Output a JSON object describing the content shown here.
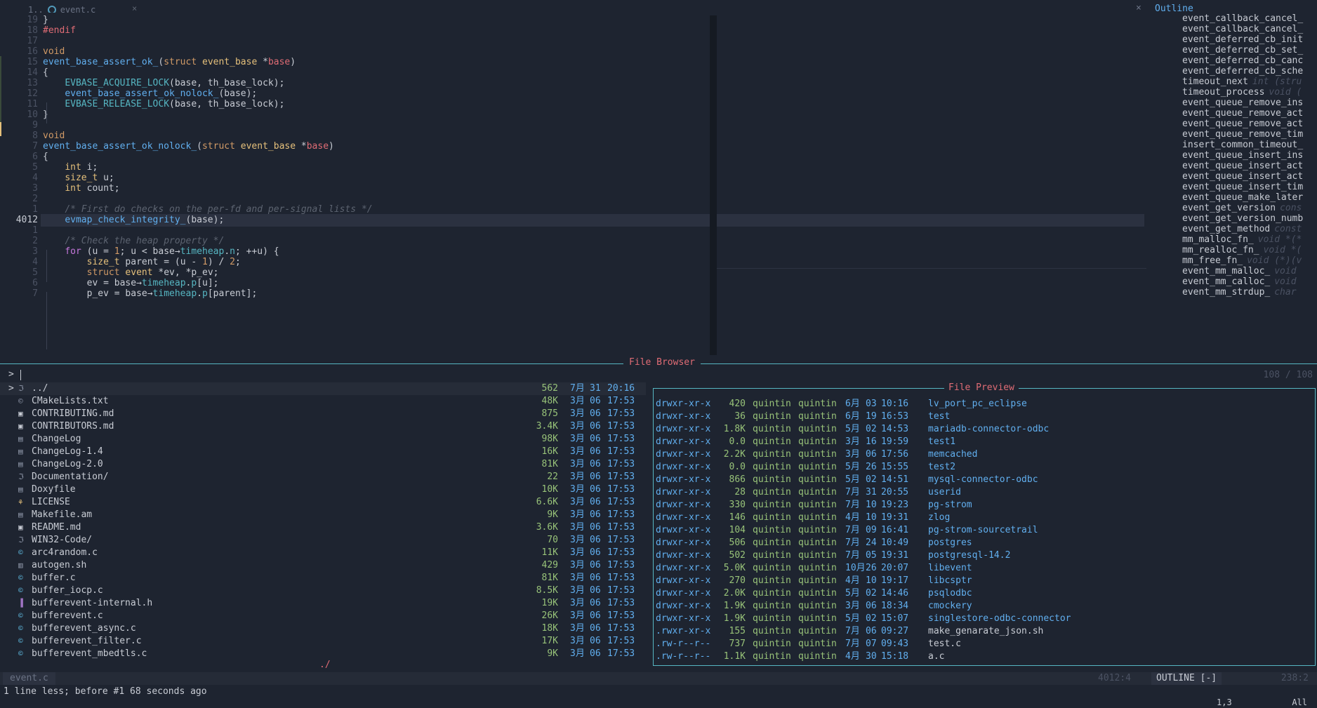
{
  "tab": {
    "prefix": "1..",
    "filename": "event.c",
    "close": "×"
  },
  "window_close": "×",
  "editor": {
    "lines": [
      {
        "n": "19",
        "html": "<span class='plain'>}</span>"
      },
      {
        "n": "18",
        "html": "<span class='pp'>#endif</span>"
      },
      {
        "n": "17",
        "html": ""
      },
      {
        "n": "16",
        "html": "<span class='kw'>void</span>"
      },
      {
        "n": "15",
        "html": "<span class='fn'>event_base_assert_ok_</span><span class='plain'>(</span><span class='kw'>struct</span> <span class='ty'>event_base</span> <span class='plain'>*</span><span class='par'>base</span><span class='plain'>)</span>"
      },
      {
        "n": "14",
        "html": "<span class='plain'>{</span>"
      },
      {
        "n": "13",
        "html": "    <span class='mac'>EVBASE_ACQUIRE_LOCK</span><span class='plain'>(base, th_base_lock);</span>"
      },
      {
        "n": "12",
        "html": "    <span class='fn'>event_base_assert_ok_nolock_</span><span class='plain'>(base);</span>"
      },
      {
        "n": "11",
        "html": "    <span class='mac'>EVBASE_RELEASE_LOCK</span><span class='plain'>(base, th_base_lock);</span>"
      },
      {
        "n": "10",
        "html": "<span class='plain'>}</span>"
      },
      {
        "n": "9",
        "html": ""
      },
      {
        "n": "8",
        "html": "<span class='kw'>void</span>"
      },
      {
        "n": "7",
        "html": "<span class='fn'>event_base_assert_ok_nolock_</span><span class='plain'>(</span><span class='kw'>struct</span> <span class='ty'>event_base</span> <span class='plain'>*</span><span class='par'>base</span><span class='plain'>)</span>"
      },
      {
        "n": "6",
        "html": "<span class='plain'>{</span>"
      },
      {
        "n": "5",
        "html": "    <span class='ty'>int</span> <span class='plain'>i;</span>"
      },
      {
        "n": "4",
        "html": "    <span class='ty'>size_t</span> <span class='plain'>u;</span>"
      },
      {
        "n": "3",
        "html": "    <span class='ty'>int</span> <span class='plain'>count;</span>"
      },
      {
        "n": "2",
        "html": ""
      },
      {
        "n": "1",
        "html": "    <span class='cm'>/* First do checks on the per-fd and per-signal lists */</span>"
      },
      {
        "n": "4012",
        "html": "    <span class='fn'>evmap_check_integrity_</span><span class='plain'>(base);</span>",
        "current": true
      },
      {
        "n": "1",
        "html": ""
      },
      {
        "n": "2",
        "html": "    <span class='cm'>/* Check the heap property */</span>"
      },
      {
        "n": "3",
        "html": "    <span class='purple'>for</span> <span class='plain'>(u = </span><span class='num'>1</span><span class='plain'>; u &lt; base→</span><span class='fld'>timeheap</span><span class='plain'>.</span><span class='fld'>n</span><span class='plain'>; ++u) {</span>"
      },
      {
        "n": "4",
        "html": "        <span class='ty'>size_t</span> <span class='plain'>parent = (u - </span><span class='num'>1</span><span class='plain'>) / </span><span class='num'>2</span><span class='plain'>;</span>"
      },
      {
        "n": "5",
        "html": "        <span class='kw'>struct</span> <span class='ty'>event</span> <span class='plain'>*ev, *p_ev;</span>"
      },
      {
        "n": "6",
        "html": "        <span class='plain'>ev = base→</span><span class='fld'>timeheap</span><span class='plain'>.</span><span class='fld'>p</span><span class='plain'>[u];</span>"
      },
      {
        "n": "7",
        "html": "        <span class='plain'>p_ev = base→</span><span class='fld'>timeheap</span><span class='plain'>.</span><span class='fld'>p</span><span class='plain'>[parent];</span>"
      }
    ]
  },
  "outline": {
    "title": "Outline",
    "items": [
      {
        "icon": "f",
        "name": "event_callback_cancel_",
        "sig": ""
      },
      {
        "icon": "f",
        "name": "event_callback_cancel_",
        "sig": ""
      },
      {
        "icon": "f",
        "name": "event_deferred_cb_init",
        "sig": ""
      },
      {
        "icon": "f",
        "name": "event_deferred_cb_set_",
        "sig": ""
      },
      {
        "icon": "f",
        "name": "event_deferred_cb_canc",
        "sig": ""
      },
      {
        "icon": "f",
        "name": "event_deferred_cb_sche",
        "sig": ""
      },
      {
        "icon": "f",
        "name": "timeout_next",
        "sig": "int (stru"
      },
      {
        "icon": "f",
        "name": "timeout_process",
        "sig": "void ("
      },
      {
        "icon": "f",
        "name": "event_queue_remove_ins",
        "sig": ""
      },
      {
        "icon": "f",
        "name": "event_queue_remove_act",
        "sig": ""
      },
      {
        "icon": "f",
        "name": "event_queue_remove_act",
        "sig": ""
      },
      {
        "icon": "f",
        "name": "event_queue_remove_tim",
        "sig": ""
      },
      {
        "icon": "f",
        "name": "insert_common_timeout_",
        "sig": ""
      },
      {
        "icon": "f",
        "name": "event_queue_insert_ins",
        "sig": ""
      },
      {
        "icon": "f",
        "name": "event_queue_insert_act",
        "sig": ""
      },
      {
        "icon": "f",
        "name": "event_queue_insert_act",
        "sig": ""
      },
      {
        "icon": "f",
        "name": "event_queue_insert_tim",
        "sig": ""
      },
      {
        "icon": "f",
        "name": "event_queue_make_later",
        "sig": ""
      },
      {
        "icon": "f",
        "name": "event_get_version",
        "sig": "cons"
      },
      {
        "icon": "f",
        "name": "event_get_version_numb",
        "sig": ""
      },
      {
        "icon": "f",
        "name": "event_get_method",
        "sig": "const"
      },
      {
        "icon": "v",
        "name": "mm_malloc_fn_",
        "sig": "void *(*"
      },
      {
        "icon": "v",
        "name": "mm_realloc_fn_",
        "sig": "void *("
      },
      {
        "icon": "v",
        "name": "mm_free_fn_",
        "sig": "void (*)(v"
      },
      {
        "icon": "f",
        "name": "event_mm_malloc_",
        "sig": "void"
      },
      {
        "icon": "f",
        "name": "event_mm_calloc_",
        "sig": "void"
      },
      {
        "icon": "f",
        "name": "event_mm_strdup_",
        "sig": "char"
      }
    ]
  },
  "file_browser": {
    "title": "File Browser",
    "prompt": ">",
    "count": "108 / 108",
    "cwd_label": "./",
    "files": [
      {
        "icon": "dir",
        "name": "../",
        "size": "562",
        "mon": "7月",
        "day": "31",
        "time": "20:16",
        "selected": true
      },
      {
        "icon": "cmake",
        "name": "CMakeLists.txt",
        "size": "48K",
        "mon": "3月",
        "day": "06",
        "time": "17:53"
      },
      {
        "icon": "md",
        "name": "CONTRIBUTING.md",
        "size": "875",
        "mon": "3月",
        "day": "06",
        "time": "17:53"
      },
      {
        "icon": "md",
        "name": "CONTRIBUTORS.md",
        "size": "3.4K",
        "mon": "3月",
        "day": "06",
        "time": "17:53"
      },
      {
        "icon": "doc",
        "name": "ChangeLog",
        "size": "98K",
        "mon": "3月",
        "day": "06",
        "time": "17:53"
      },
      {
        "icon": "doc",
        "name": "ChangeLog-1.4",
        "size": "16K",
        "mon": "3月",
        "day": "06",
        "time": "17:53"
      },
      {
        "icon": "doc",
        "name": "ChangeLog-2.0",
        "size": "81K",
        "mon": "3月",
        "day": "06",
        "time": "17:53"
      },
      {
        "icon": "dir",
        "name": "Documentation/",
        "size": "22",
        "mon": "3月",
        "day": "06",
        "time": "17:53"
      },
      {
        "icon": "doc",
        "name": "Doxyfile",
        "size": "10K",
        "mon": "3月",
        "day": "06",
        "time": "17:53"
      },
      {
        "icon": "lic",
        "name": "LICENSE",
        "size": "6.6K",
        "mon": "3月",
        "day": "06",
        "time": "17:53"
      },
      {
        "icon": "doc",
        "name": "Makefile.am",
        "size": "9K",
        "mon": "3月",
        "day": "06",
        "time": "17:53"
      },
      {
        "icon": "md",
        "name": "README.md",
        "size": "3.6K",
        "mon": "3月",
        "day": "06",
        "time": "17:53"
      },
      {
        "icon": "dir",
        "name": "WIN32-Code/",
        "size": "70",
        "mon": "3月",
        "day": "06",
        "time": "17:53"
      },
      {
        "icon": "c",
        "name": "arc4random.c",
        "size": "11K",
        "mon": "3月",
        "day": "06",
        "time": "17:53"
      },
      {
        "icon": "sh",
        "name": "autogen.sh",
        "size": "429",
        "mon": "3月",
        "day": "06",
        "time": "17:53"
      },
      {
        "icon": "c",
        "name": "buffer.c",
        "size": "81K",
        "mon": "3月",
        "day": "06",
        "time": "17:53"
      },
      {
        "icon": "c",
        "name": "buffer_iocp.c",
        "size": "8.5K",
        "mon": "3月",
        "day": "06",
        "time": "17:53"
      },
      {
        "icon": "h",
        "name": "bufferevent-internal.h",
        "size": "19K",
        "mon": "3月",
        "day": "06",
        "time": "17:53"
      },
      {
        "icon": "c",
        "name": "bufferevent.c",
        "size": "26K",
        "mon": "3月",
        "day": "06",
        "time": "17:53"
      },
      {
        "icon": "c",
        "name": "bufferevent_async.c",
        "size": "18K",
        "mon": "3月",
        "day": "06",
        "time": "17:53"
      },
      {
        "icon": "c",
        "name": "bufferevent_filter.c",
        "size": "17K",
        "mon": "3月",
        "day": "06",
        "time": "17:53"
      },
      {
        "icon": "c",
        "name": "bufferevent_mbedtls.c",
        "size": "9K",
        "mon": "3月",
        "day": "06",
        "time": "17:53"
      }
    ]
  },
  "preview": {
    "title": "File Preview",
    "rows": [
      {
        "perm": "drwxr-xr-x",
        "size": "420",
        "user": "quintin",
        "group": "quintin",
        "mon": "6月",
        "day": "03",
        "time": "10:16",
        "name": "lv_port_pc_eclipse",
        "dir": true
      },
      {
        "perm": "drwxr-xr-x",
        "size": "36",
        "user": "quintin",
        "group": "quintin",
        "mon": "6月",
        "day": "19",
        "time": "16:53",
        "name": "test",
        "dir": true
      },
      {
        "perm": "drwxr-xr-x",
        "size": "1.8K",
        "user": "quintin",
        "group": "quintin",
        "mon": "5月",
        "day": "02",
        "time": "14:53",
        "name": "mariadb-connector-odbc",
        "dir": true
      },
      {
        "perm": "drwxr-xr-x",
        "size": "0.0",
        "user": "quintin",
        "group": "quintin",
        "mon": "3月",
        "day": "16",
        "time": "19:59",
        "name": "test1",
        "dir": true
      },
      {
        "perm": "drwxr-xr-x",
        "size": "2.2K",
        "user": "quintin",
        "group": "quintin",
        "mon": "3月",
        "day": "06",
        "time": "17:56",
        "name": "memcached",
        "dir": true
      },
      {
        "perm": "drwxr-xr-x",
        "size": "0.0",
        "user": "quintin",
        "group": "quintin",
        "mon": "5月",
        "day": "26",
        "time": "15:55",
        "name": "test2",
        "dir": true
      },
      {
        "perm": "drwxr-xr-x",
        "size": "866",
        "user": "quintin",
        "group": "quintin",
        "mon": "5月",
        "day": "02",
        "time": "14:51",
        "name": "mysql-connector-odbc",
        "dir": true
      },
      {
        "perm": "drwxr-xr-x",
        "size": "28",
        "user": "quintin",
        "group": "quintin",
        "mon": "7月",
        "day": "31",
        "time": "20:55",
        "name": "userid",
        "dir": true
      },
      {
        "perm": "drwxr-xr-x",
        "size": "330",
        "user": "quintin",
        "group": "quintin",
        "mon": "7月",
        "day": "10",
        "time": "19:23",
        "name": "pg-strom",
        "dir": true
      },
      {
        "perm": "drwxr-xr-x",
        "size": "146",
        "user": "quintin",
        "group": "quintin",
        "mon": "4月",
        "day": "10",
        "time": "19:31",
        "name": "zlog",
        "dir": true
      },
      {
        "perm": "drwxr-xr-x",
        "size": "104",
        "user": "quintin",
        "group": "quintin",
        "mon": "7月",
        "day": "09",
        "time": "16:41",
        "name": "pg-strom-sourcetrail",
        "dir": true
      },
      {
        "perm": "drwxr-xr-x",
        "size": "506",
        "user": "quintin",
        "group": "quintin",
        "mon": "7月",
        "day": "24",
        "time": "10:49",
        "name": "postgres",
        "dir": true
      },
      {
        "perm": "drwxr-xr-x",
        "size": "502",
        "user": "quintin",
        "group": "quintin",
        "mon": "7月",
        "day": "05",
        "time": "19:31",
        "name": "postgresql-14.2",
        "dir": true
      },
      {
        "perm": "drwxr-xr-x",
        "size": "5.0K",
        "user": "quintin",
        "group": "quintin",
        "mon": "10月",
        "day": "26",
        "time": "20:07",
        "name": "libevent",
        "dir": true
      },
      {
        "perm": "drwxr-xr-x",
        "size": "270",
        "user": "quintin",
        "group": "quintin",
        "mon": "4月",
        "day": "10",
        "time": "19:17",
        "name": "libcsptr",
        "dir": true
      },
      {
        "perm": "drwxr-xr-x",
        "size": "2.0K",
        "user": "quintin",
        "group": "quintin",
        "mon": "5月",
        "day": "02",
        "time": "14:46",
        "name": "psqlodbc",
        "dir": true
      },
      {
        "perm": "drwxr-xr-x",
        "size": "1.9K",
        "user": "quintin",
        "group": "quintin",
        "mon": "3月",
        "day": "06",
        "time": "18:34",
        "name": "cmockery",
        "dir": true
      },
      {
        "perm": "drwxr-xr-x",
        "size": "1.9K",
        "user": "quintin",
        "group": "quintin",
        "mon": "5月",
        "day": "02",
        "time": "15:07",
        "name": "singlestore-odbc-connector",
        "dir": true
      },
      {
        "perm": ".rwxr-xr-x",
        "size": "155",
        "user": "quintin",
        "group": "quintin",
        "mon": "7月",
        "day": "06",
        "time": "09:27",
        "name": "make_genarate_json.sh",
        "dir": false
      },
      {
        "perm": ".rw-r--r--",
        "size": "737",
        "user": "quintin",
        "group": "quintin",
        "mon": "7月",
        "day": "07",
        "time": "09:43",
        "name": "test.c",
        "dir": false
      },
      {
        "perm": ".rw-r--r--",
        "size": "1.1K",
        "user": "quintin",
        "group": "quintin",
        "mon": "4月",
        "day": "30",
        "time": "15:18",
        "name": "a.c",
        "dir": false
      }
    ]
  },
  "statusline": {
    "file": "event.c",
    "position": "4012:4",
    "outline_mode": "OUTLINE [-]",
    "outline_position": "238:2"
  },
  "message": "1 line less; before #1  68 seconds ago",
  "ruler": {
    "pos": "1,3",
    "scroll": "All"
  },
  "colors": {
    "background": "#1e2430",
    "accent": "#56b6c2",
    "title": "#e06c75",
    "directory": "#61afef",
    "size": "#98c379"
  }
}
